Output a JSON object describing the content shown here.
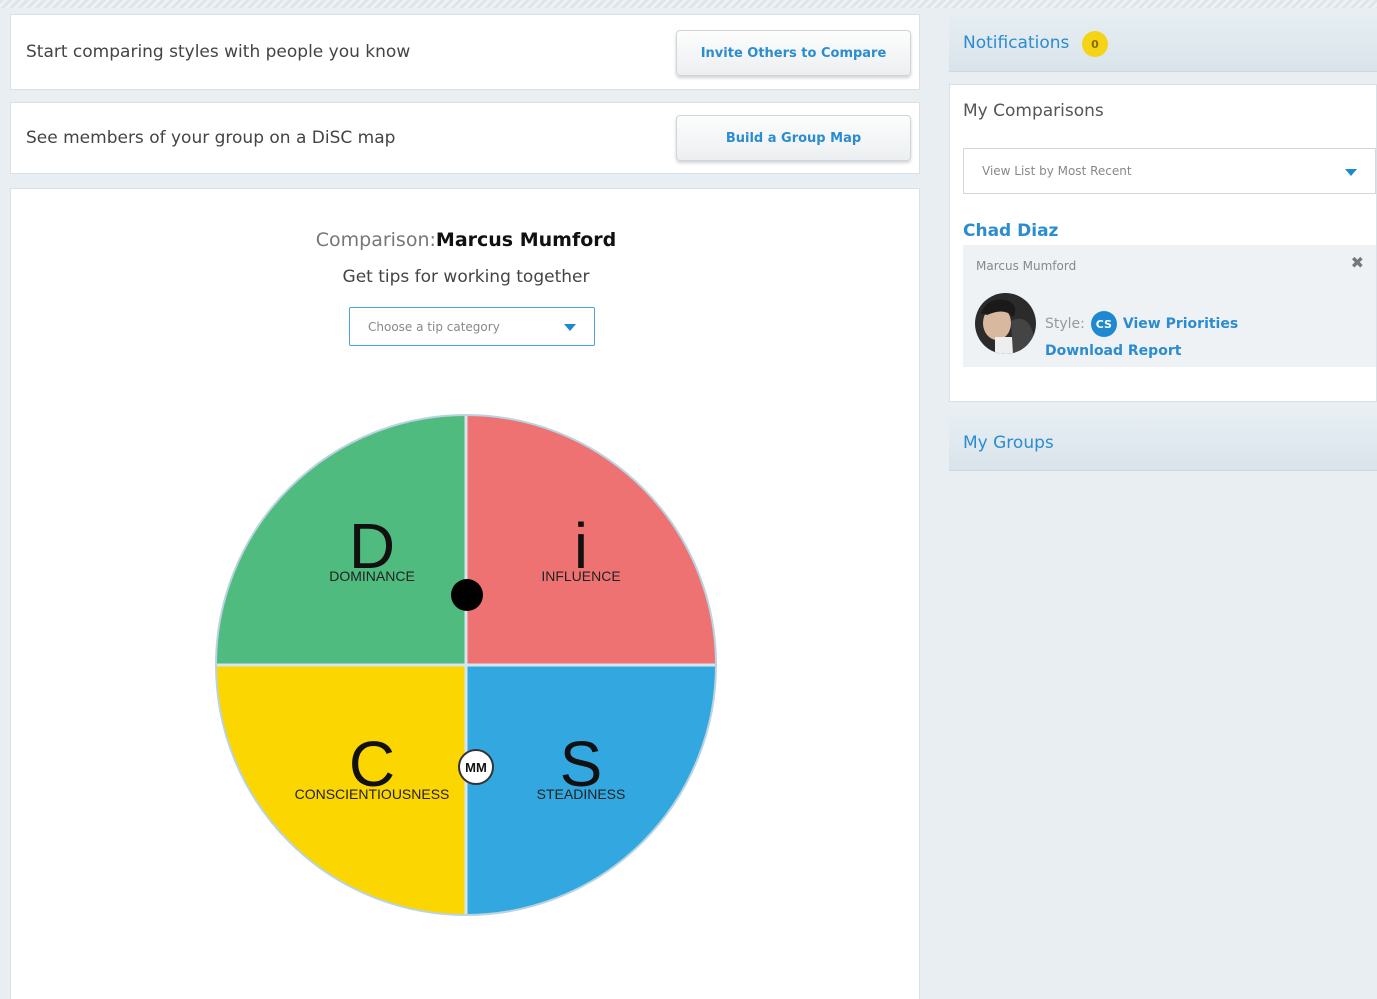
{
  "promos": [
    {
      "text": "Start comparing styles with people you know",
      "button": "Invite Others to Compare"
    },
    {
      "text": "See members of your group on a DiSC map",
      "button": "Build a Group Map"
    }
  ],
  "comparison": {
    "prefix": "Comparison:",
    "name": "Marcus Mumford",
    "tips_heading": "Get tips for working together",
    "tip_select_placeholder": "Choose a tip category"
  },
  "disc_map": {
    "quadrants": [
      {
        "letter": "D",
        "label": "DOMINANCE",
        "color": "#4fbb7e"
      },
      {
        "letter": "i",
        "label": "INFLUENCE",
        "color": "#ef7272"
      },
      {
        "letter": "C",
        "label": "CONSCIENTIOUSNESS",
        "color": "#fcd600"
      },
      {
        "letter": "S",
        "label": "STEADINESS",
        "color": "#33a8e0"
      }
    ],
    "marker_initials": "MM"
  },
  "sidebar": {
    "notifications": {
      "label": "Notifications",
      "count": "0"
    },
    "my_comparisons": {
      "title": "My Comparisons",
      "sort_select": "View List by Most Recent",
      "entry": {
        "name": "Chad Diaz",
        "subtitle": "Marcus Mumford",
        "style_label": "Style:",
        "style_badge": "CS",
        "view_priorities": "View Priorities",
        "download_report": "Download Report"
      }
    },
    "my_groups": {
      "label": "My Groups"
    }
  },
  "colors": {
    "accent": "#2b8ccf",
    "badge": "#f5d416"
  }
}
